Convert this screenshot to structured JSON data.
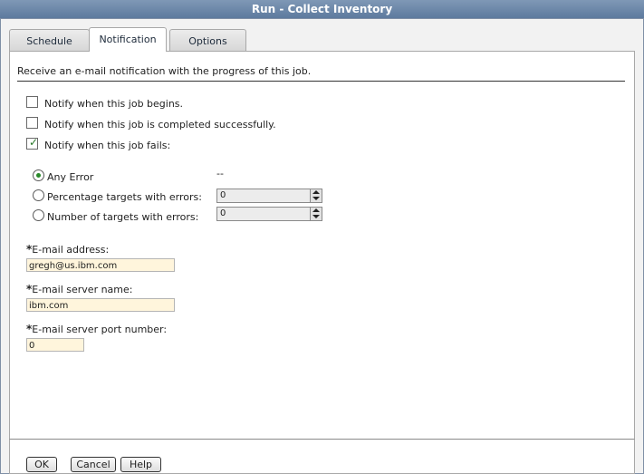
{
  "window": {
    "title": "Run - Collect Inventory"
  },
  "tabs": [
    {
      "label": "Schedule"
    },
    {
      "label": "Notification"
    },
    {
      "label": "Options"
    }
  ],
  "panel": {
    "intro": "Receive an e-mail notification with the progress of this job.",
    "notify_begins": {
      "label": "Notify when this job begins.",
      "checked": false
    },
    "notify_completed": {
      "label": "Notify when this job is completed successfully.",
      "checked": false
    },
    "notify_fails": {
      "label": "Notify when this job fails:",
      "checked": true
    },
    "radio_any_error": {
      "label": "Any Error",
      "selected": true,
      "value": "--"
    },
    "radio_percentage": {
      "label": "Percentage targets with errors:",
      "selected": false,
      "value": "0"
    },
    "radio_number": {
      "label": "Number of targets with errors:",
      "selected": false,
      "value": "0"
    },
    "required_marker": "*",
    "email_address": {
      "label": "E-mail address:",
      "value": "gregh@us.ibm.com"
    },
    "email_server": {
      "label": "E-mail server name:",
      "value": "ibm.com"
    },
    "email_port": {
      "label": "E-mail server port number:",
      "value": "0"
    }
  },
  "buttons": {
    "ok": "OK",
    "cancel": "Cancel",
    "help": "Help"
  },
  "colors": {
    "titlebar": "#6a86a8",
    "field_bg": "#fff5dc",
    "check_green": "#2a7a2a"
  }
}
